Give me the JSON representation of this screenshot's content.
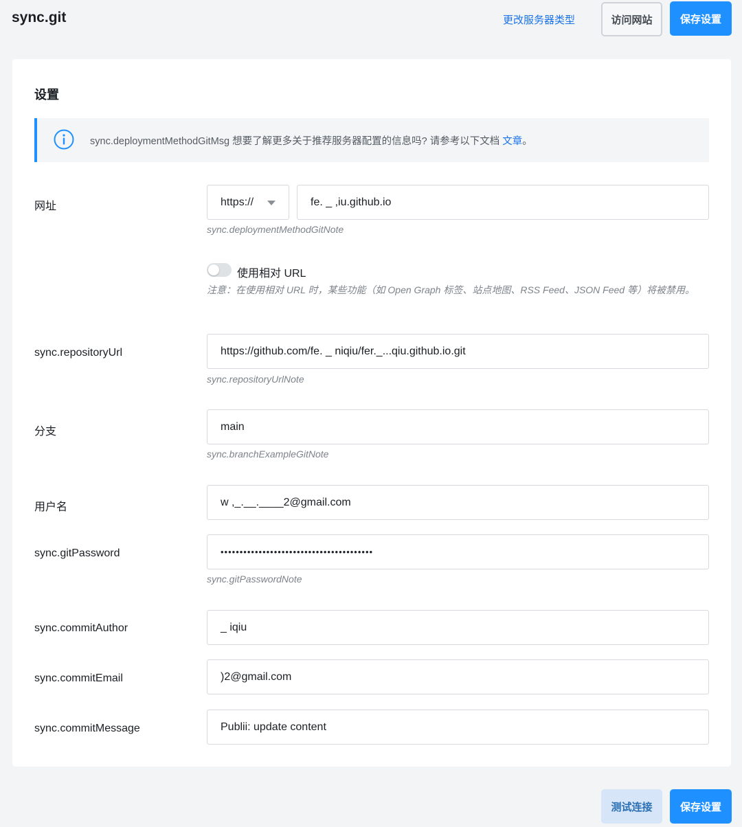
{
  "header": {
    "title": "sync.git",
    "change_server_label": "更改服务器类型",
    "visit_site_label": "访问网站",
    "save_label": "保存设置"
  },
  "settings": {
    "title": "设置",
    "notice": {
      "text": "sync.deploymentMethodGitMsg 想要了解更多关于推荐服务器配置的信息吗? 请参考以下文档",
      "link": "文章",
      "suffix": "。"
    },
    "url": {
      "label": "网址",
      "protocol": "https://",
      "value": "fe.  _    ,iu.github.io",
      "note": "sync.deploymentMethodGitNote"
    },
    "relative_url": {
      "label": "使用相对 URL",
      "enabled": false,
      "note": "注意：在使用相对 URL 时，某些功能（如 Open Graph 标签、站点地图、RSS Feed、JSON Feed 等）将被禁用。"
    },
    "repository_url": {
      "label": "sync.repositoryUrl",
      "value": "https://github.com/fe.  _   niqiu/fer._...qiu.github.io.git",
      "note": "sync.repositoryUrlNote"
    },
    "branch": {
      "label": "分支",
      "value": "main",
      "note": "sync.branchExampleGitNote"
    },
    "username": {
      "label": "用户名",
      "value": "w          ,_.__.____2@gmail.com"
    },
    "password": {
      "label": "sync.gitPassword",
      "value": "••••••••••••••••••••••••••••••••••••••••",
      "note": "sync.gitPasswordNote"
    },
    "commit_author": {
      "label": "sync.commitAuthor",
      "value": "      _  iqiu"
    },
    "commit_email": {
      "label": "sync.commitEmail",
      "value": "                        )2@gmail.com"
    },
    "commit_message": {
      "label": "sync.commitMessage",
      "value": "Publii: update content"
    }
  },
  "footer": {
    "test_connection_label": "测试连接",
    "save_label": "保存设置"
  },
  "colors": {
    "primary": "#1e90ff",
    "link": "#1a73e8",
    "background": "#f3f4f6"
  }
}
